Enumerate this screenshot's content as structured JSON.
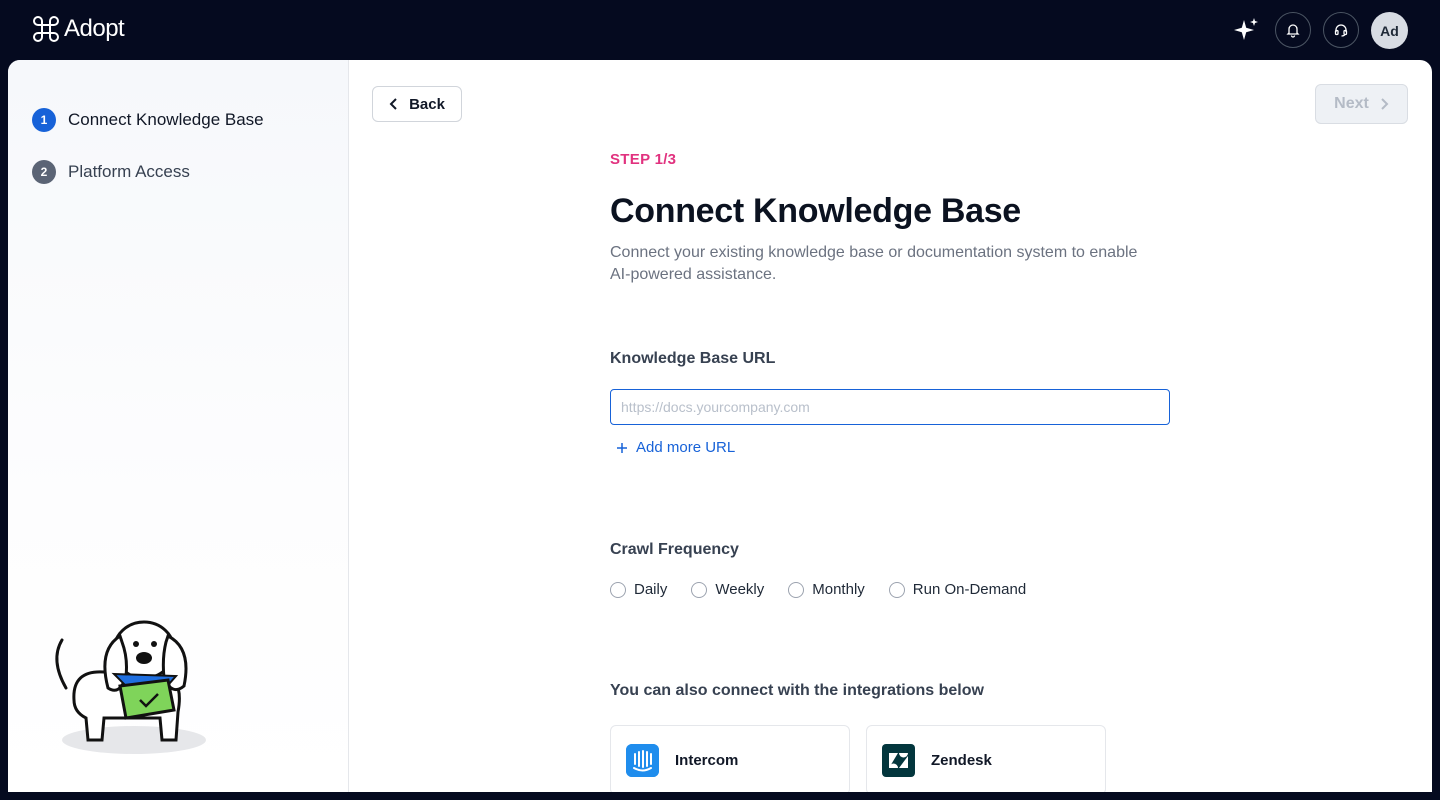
{
  "header": {
    "brand": "Adopt",
    "avatar_initials": "Ad",
    "icons": [
      "sparkle-icon",
      "bell-icon",
      "headset-icon"
    ]
  },
  "sidebar": {
    "steps": [
      {
        "number": "1",
        "label": "Connect Knowledge Base",
        "active": true
      },
      {
        "number": "2",
        "label": "Platform Access",
        "active": false
      }
    ]
  },
  "nav": {
    "back_label": "Back",
    "next_label": "Next"
  },
  "main": {
    "step_tag": "STEP 1/3",
    "title": "Connect Knowledge Base",
    "subtitle": "Connect your existing knowledge base or documentation system to enable AI-powered assistance.",
    "url_label": "Knowledge Base URL",
    "url_placeholder": "https://docs.yourcompany.com",
    "url_value": "",
    "add_url_label": "Add more URL",
    "crawl_label": "Crawl Frequency",
    "crawl_options": [
      "Daily",
      "Weekly",
      "Monthly",
      "Run On-Demand"
    ],
    "integrations_label": "You can also connect with the integrations below",
    "integrations": [
      {
        "name": "Intercom",
        "icon": "intercom-icon"
      },
      {
        "name": "Zendesk",
        "icon": "zendesk-icon"
      }
    ]
  },
  "colors": {
    "primary": "#1762d8",
    "step_tag": "#e1327f",
    "topbar": "#050a1f",
    "intercom": "#1f8ded",
    "zendesk": "#03363d"
  }
}
